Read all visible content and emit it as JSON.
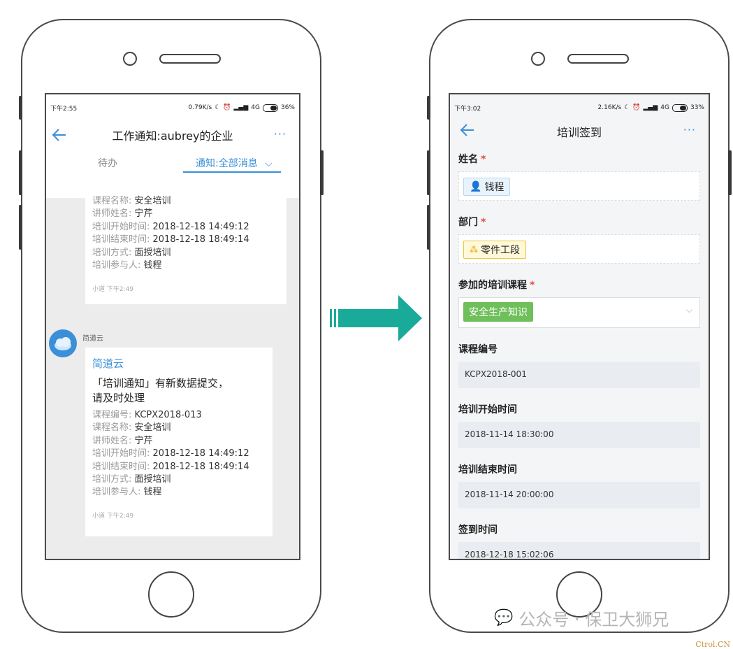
{
  "left_phone": {
    "status": {
      "time": "下午2:55",
      "speed": "0.79K/s",
      "battery_pct": "36%",
      "network": "4G"
    },
    "nav": {
      "title": "工作通知:aubrey的企业"
    },
    "tabs": [
      {
        "label": "待办"
      },
      {
        "label": "通知:全部消息"
      }
    ],
    "card1": {
      "lines": [
        {
          "k": "课程名称: ",
          "v": "安全培训"
        },
        {
          "k": "讲师姓名: ",
          "v": "宁芹"
        },
        {
          "k": "培训开始时间: ",
          "v": "2018-12-18 14:49:12"
        },
        {
          "k": "培训结束时间: ",
          "v": "2018-12-18 18:49:14"
        },
        {
          "k": "培训方式: ",
          "v": "面授培训"
        },
        {
          "k": "培训参与人: ",
          "v": "钱程"
        }
      ],
      "meta": "小道 下午2:49"
    },
    "card2": {
      "sender": "简道云",
      "title": "简道云",
      "body_line1": "「培训通知」有新数据提交，",
      "body_line2": "请及时处理",
      "lines": [
        {
          "k": "课程编号: ",
          "v": "KCPX2018-013"
        },
        {
          "k": "课程名称: ",
          "v": "安全培训"
        },
        {
          "k": "讲师姓名: ",
          "v": "宁芹"
        },
        {
          "k": "培训开始时间: ",
          "v": "2018-12-18 14:49:12"
        },
        {
          "k": "培训结束时间: ",
          "v": "2018-12-18 18:49:14"
        },
        {
          "k": "培训方式: ",
          "v": "面授培训"
        },
        {
          "k": "培训参与人: ",
          "v": "钱程"
        }
      ],
      "meta": "小道 下午2:49"
    }
  },
  "right_phone": {
    "status": {
      "time": "下午3:02",
      "speed": "2.16K/s",
      "battery_pct": "33%",
      "network": "4G"
    },
    "nav": {
      "title": "培训签到"
    },
    "form": {
      "name": {
        "label": "姓名",
        "required": "*",
        "value": "钱程"
      },
      "department": {
        "label": "部门",
        "required": "*",
        "value": "零件工段"
      },
      "course": {
        "label": "参加的培训课程",
        "required": "*",
        "value": "安全生产知识"
      },
      "course_code": {
        "label": "课程编号",
        "value": "KCPX2018-001"
      },
      "start_time": {
        "label": "培训开始时间",
        "value": "2018-11-14 18:30:00"
      },
      "end_time": {
        "label": "培训结束时间",
        "value": "2018-11-14 20:00:00"
      },
      "signin_time": {
        "label": "签到时间",
        "value": "2018-12-18 15:02:06"
      }
    }
  },
  "watermark": {
    "text": "公众号 · 保卫大狮兄",
    "site": "Ctrol.CN"
  },
  "colors": {
    "accent": "#3a8fd8",
    "arrow": "#1aaa9a",
    "required": "#e74c3c",
    "course_tag": "#6fbf5b"
  }
}
